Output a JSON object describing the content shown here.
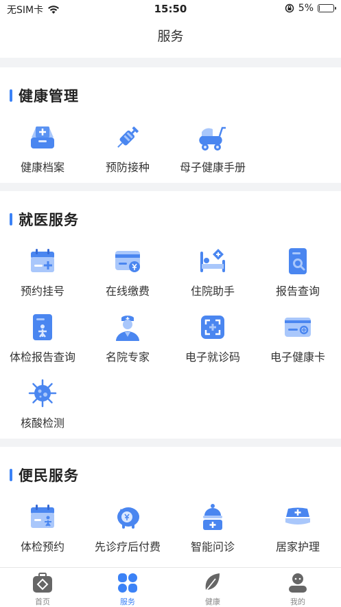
{
  "status_bar": {
    "carrier": "无SIM卡",
    "time": "15:50",
    "battery": "5%",
    "battery_level": 0.05
  },
  "nav": {
    "title": "服务"
  },
  "sections": {
    "health": {
      "title": "健康管理",
      "items": [
        {
          "label": "健康档案",
          "icon": "medical-record-icon"
        },
        {
          "label": "预防接种",
          "icon": "syringe-icon"
        },
        {
          "label": "母子健康手册",
          "icon": "baby-stroller-icon"
        }
      ]
    },
    "medical": {
      "title": "就医服务",
      "items": [
        {
          "label": "预约挂号",
          "icon": "calendar-icon"
        },
        {
          "label": "在线缴费",
          "icon": "payment-card-icon"
        },
        {
          "label": "住院助手",
          "icon": "hospital-bed-icon"
        },
        {
          "label": "报告查询",
          "icon": "report-search-icon"
        },
        {
          "label": "体检报告查询",
          "icon": "checkup-report-icon"
        },
        {
          "label": "名院专家",
          "icon": "doctor-icon"
        },
        {
          "label": "电子就诊码",
          "icon": "scan-code-icon"
        },
        {
          "label": "电子健康卡",
          "icon": "health-card-icon"
        },
        {
          "label": "核酸检测",
          "icon": "virus-icon"
        }
      ]
    },
    "convenience": {
      "title": "便民服务",
      "items": [
        {
          "label": "体检预约",
          "icon": "checkup-calendar-icon"
        },
        {
          "label": "先诊疗后付费",
          "icon": "piggy-bank-icon"
        },
        {
          "label": "智能问诊",
          "icon": "smart-consult-icon"
        },
        {
          "label": "居家护理",
          "icon": "nurse-cap-icon"
        }
      ]
    }
  },
  "tabs": [
    {
      "label": "首页",
      "icon": "home-medkit-icon",
      "active": false
    },
    {
      "label": "服务",
      "icon": "grid-icon",
      "active": true
    },
    {
      "label": "健康",
      "icon": "leaf-icon",
      "active": false
    },
    {
      "label": "我的",
      "icon": "profile-icon",
      "active": false
    }
  ],
  "colors": {
    "accent": "#3b82f6",
    "icon_light": "#a9c7fb",
    "icon_dark": "#4a86f0"
  }
}
